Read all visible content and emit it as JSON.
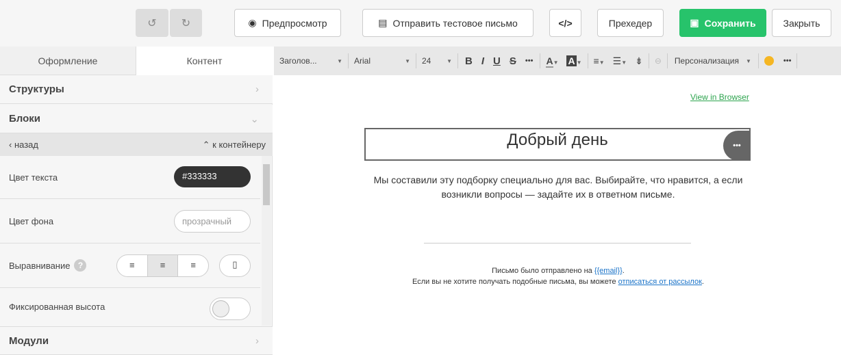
{
  "topbar": {
    "undo_icon": "history-back-icon",
    "redo_icon": "history-forward-icon",
    "preview": "Предпросмотр",
    "send_test": "Отправить тестовое письмо",
    "code": "</>",
    "preheader": "Прехедер",
    "save": "Сохранить",
    "close": "Закрыть"
  },
  "tabs": [
    "Оформление",
    "Контент"
  ],
  "sidebar": {
    "structures": "Структуры",
    "blocks": "Блоки",
    "back": "назад",
    "to_container": "к контейнеру",
    "modules": "Модули",
    "text_color_label": "Цвет текста",
    "text_color_value": "#333333",
    "bg_color_label": "Цвет фона",
    "bg_color_value": "прозрачный",
    "align_label": "Выравнивание",
    "help": "?",
    "fixed_height_label": "Фиксированная высота"
  },
  "toolbar": {
    "format": "Заголов...",
    "font": "Arial",
    "size": "24",
    "bold": "B",
    "italic": "I",
    "underline": "U",
    "strike": "S",
    "more": "•••",
    "font_color": "A",
    "bg_color": "A",
    "personalization": "Персонализация",
    "more2": "•••"
  },
  "email": {
    "view_in_browser": "View in Browser",
    "heading": "Добрый день",
    "body": "Мы составили эту подборку специально для вас. Выбирайте, что нравится, а если возникли вопросы — задайте их в ответном письме.",
    "footer1": "Письмо было отправлено на ",
    "email_tag": "{{email}}",
    "footer2": "Если вы не хотите получать подобные письма, вы можете ",
    "unsubscribe": "отписаться от рассылок",
    "dot": ".",
    "more": "•••"
  },
  "colors": {
    "accent": "#27c36b",
    "link": "#1a73c8",
    "green_link": "#2da44e"
  }
}
